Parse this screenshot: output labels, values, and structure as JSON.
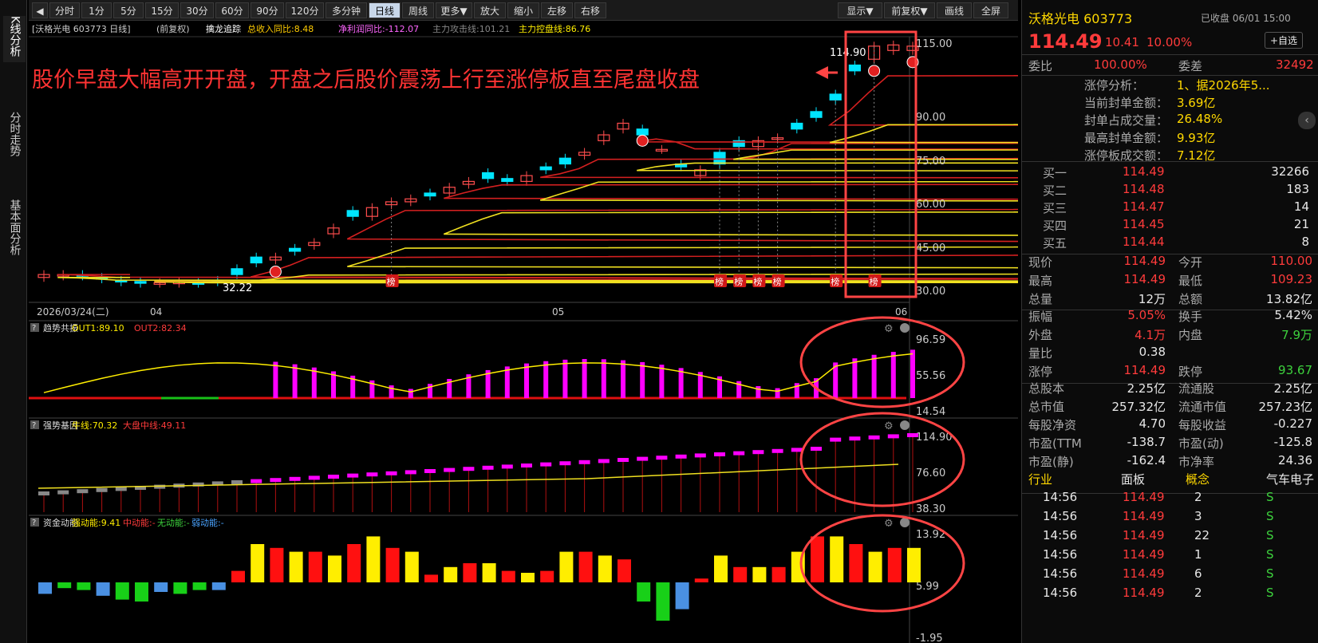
{
  "toolbar": {
    "buttons": [
      "分时",
      "1分",
      "5分",
      "15分",
      "30分",
      "60分",
      "90分",
      "120分",
      "多分钟",
      "日线",
      "周线",
      "更多▼",
      "放大",
      "缩小",
      "左移",
      "右移"
    ],
    "right_buttons": [
      "显示▼",
      "前复权▼",
      "画线",
      "全屏"
    ],
    "active": "日线"
  },
  "sidetabs": [
    "K线分析",
    "分时走势",
    "基本面分析"
  ],
  "info_bar": {
    "stock": "[沃格光电 603773 日线]",
    "adj": "(前复权)",
    "indicator": "擒龙追踪",
    "rev": "总收入同比:8.48",
    "profit": "净利润同比:-112.07",
    "attack": "主力攻击线:101.21",
    "control": "主力控盘线:86.76"
  },
  "headline": "股价早盘大幅高开开盘，开盘之后股价震荡上行至涨停板直至尾盘收盘",
  "price_axis": [
    "115.00",
    "90.00",
    "75.00",
    "60.00",
    "45.00",
    "30.00"
  ],
  "annotations": {
    "high": "114.90",
    "low": "32.22",
    "bang": "榜"
  },
  "date_axis": {
    "first": "2026/03/24(二)",
    "m1": "04",
    "m2": "05",
    "m3": "06"
  },
  "panels": [
    {
      "q": "?",
      "name": "趋势共振",
      "l1": "OUT1:89.10",
      "l2": "OUT2:82.34",
      "l3": "",
      "l4": "",
      "ticks": [
        "96.59",
        "55.56",
        "14.54"
      ]
    },
    {
      "q": "?",
      "name": "强势基因",
      "l1": "牛线:70.32",
      "l2": "大盘中线:49.11",
      "l3": "",
      "l4": "",
      "ticks": [
        "114.90",
        "76.60",
        "38.30"
      ]
    },
    {
      "q": "?",
      "name": "资金动能",
      "l1": "强动能:9.41",
      "l2": "中动能:-",
      "l3": "无动能:-",
      "l4": "弱动能:-",
      "ticks": [
        "13.92",
        "5.99",
        "-1.95"
      ]
    }
  ],
  "panel": {
    "name": "沃格光电 603773",
    "status": "已收盘 06/01 15:00",
    "price": "114.49",
    "chg": "10.41",
    "pct": "10.00%",
    "add_btn": "+自选",
    "weibi_l": "委比",
    "weibi_v": "100.00%",
    "weicha_l": "委差",
    "weicha_v": "32492",
    "limit_rows": [
      [
        "涨停分析：",
        "1、据2026年5..."
      ],
      [
        "当前封单金额：",
        "3.69亿"
      ],
      [
        "封单占成交量：",
        "26.48%"
      ],
      [
        "最高封单金额：",
        "9.93亿"
      ],
      [
        "涨停板成交额：",
        "7.12亿"
      ]
    ],
    "bids": [
      [
        "买一",
        "114.49",
        "32266"
      ],
      [
        "买二",
        "114.48",
        "183"
      ],
      [
        "买三",
        "114.47",
        "14"
      ],
      [
        "买四",
        "114.45",
        "21"
      ],
      [
        "买五",
        "114.44",
        "8"
      ]
    ],
    "stats1": [
      [
        "现价",
        "114.49",
        "今开",
        "110.00"
      ],
      [
        "最高",
        "114.49",
        "最低",
        "109.23"
      ],
      [
        "总量",
        "12万",
        "总额",
        "13.82亿"
      ]
    ],
    "stats2": [
      [
        "振幅",
        "5.05%",
        "换手",
        "5.42%"
      ],
      [
        "外盘",
        "4.1万",
        "内盘",
        "7.9万"
      ],
      [
        "量比",
        "0.38",
        "",
        ""
      ],
      [
        "涨停",
        "114.49",
        "跌停",
        "93.67"
      ]
    ],
    "stats3": [
      [
        "总股本",
        "2.25亿",
        "流通股",
        "2.25亿"
      ],
      [
        "总市值",
        "257.32亿",
        "流通市值",
        "257.23亿"
      ],
      [
        "每股净资",
        "4.70",
        "每股收益",
        "-0.227"
      ],
      [
        "市盈(TTM",
        "-138.7",
        "市盈(动)",
        "-125.8"
      ],
      [
        "市盈(静)",
        "-162.4",
        "市净率",
        "24.36"
      ]
    ],
    "tabs": [
      "行业",
      "面板",
      "概念",
      "气车电子"
    ],
    "trades": [
      [
        "14:56",
        "114.49",
        "2",
        "S"
      ],
      [
        "14:56",
        "114.49",
        "3",
        "S"
      ],
      [
        "14:56",
        "114.49",
        "22",
        "S"
      ],
      [
        "14:56",
        "114.49",
        "1",
        "S"
      ],
      [
        "14:56",
        "114.49",
        "6",
        "S"
      ],
      [
        "14:56",
        "114.49",
        "2",
        "S"
      ]
    ]
  }
}
